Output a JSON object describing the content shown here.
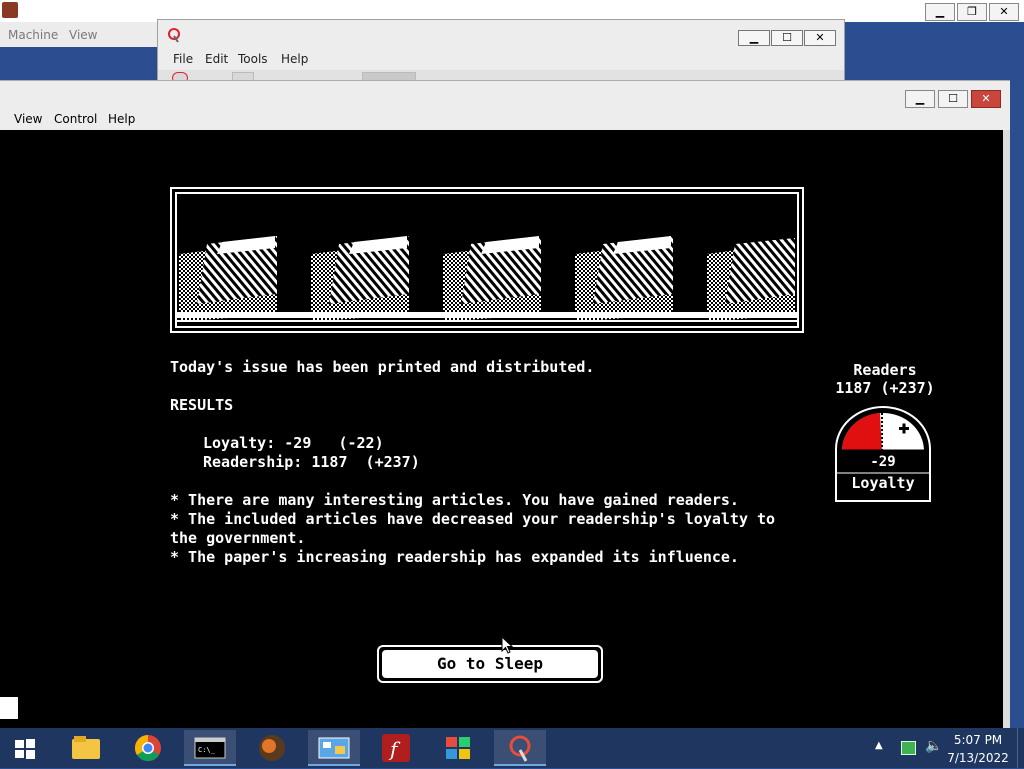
{
  "host": {
    "menu": [
      "Machine",
      "View"
    ],
    "controls": {
      "minimize": "▁",
      "restore": "❐",
      "close": "✕"
    }
  },
  "mid_window": {
    "menu": [
      "File",
      "Edit",
      "Tools",
      "Help"
    ],
    "controls": {
      "minimize": "▁",
      "maximize": "☐",
      "close": "✕"
    }
  },
  "vm_window": {
    "menu": [
      "View",
      "Control",
      "Help"
    ],
    "controls": {
      "minimize": "▁",
      "maximize": "☐",
      "close": "✕"
    }
  },
  "game": {
    "headline": "Today's issue has been printed and distributed.",
    "results_heading": "RESULTS",
    "results": [
      "Loyalty: -29   (-22)",
      "Readership: 1187  (+237)"
    ],
    "notes": [
      "* There are many interesting articles. You have gained readers.",
      "* The included articles have decreased your readership's loyalty to",
      "the government.",
      "* The paper's increasing readership has expanded its influence."
    ],
    "readers_label": "Readers",
    "readers_value": "1187 (+237)",
    "loyalty_value": "-29",
    "loyalty_label": "Loyalty",
    "sleep_button": "Go to Sleep"
  },
  "taskbar": {
    "items": [
      "file-explorer",
      "chrome",
      "command-prompt",
      "browser-app",
      "control-panel",
      "flash",
      "windows-app",
      "paint-app"
    ],
    "time": "5:07 PM",
    "date": "7/13/2022"
  },
  "colors": {
    "accent_red": "#e01010",
    "taskbar": "#1f3760",
    "screen": "#000000"
  }
}
